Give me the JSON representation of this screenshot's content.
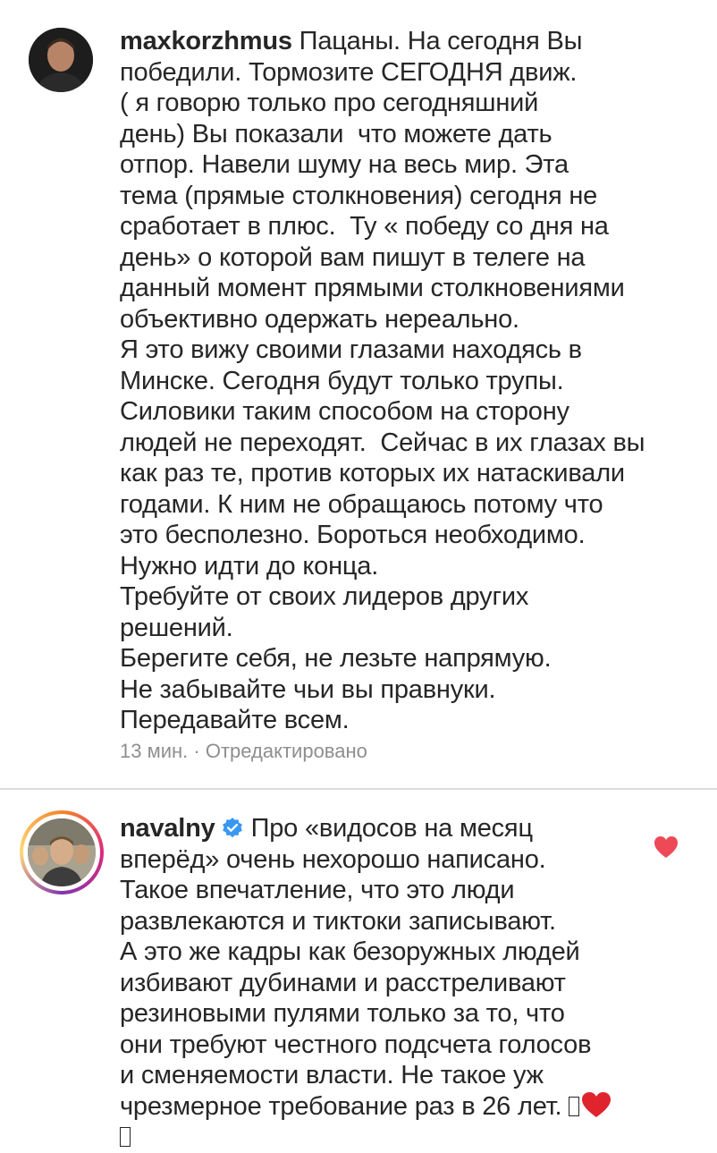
{
  "comments": [
    {
      "username": "maxkorzhmus",
      "body": " Пацаны. На сегодня Вы\nпобедили. Тормозите СЕГОДНЯ движ.\n( я говорю только про сегодняшний\nдень) Вы показали  что можете дать\nотпор. Навели шуму на весь мир. Эта\nтема (прямые столкновения) сегодня не\nсработает в плюс.  Ту « победу со дня на\nдень» о которой вам пишут в телеге на\nданный момент прямыми столкновениями\nобъективно одержать нереально.\nЯ это вижу своими глазами находясь в\nМинске. Сегодня будут только трупы.\nСиловики таким способом на сторону\nлюдей не переходят.  Сейчас в их глазах вы\nкак раз те, против которых их натаскивали\nгодами. К ним не обращаюсь потому что\nэто бесполезно. Бороться необходимо.\nНужно идти до конца.\nТребуйте от своих лидеров других\nрешений.\nБерегите себя, не лезьте напрямую.\nНе забывайте чьи вы правнуки.\nПередавайте всем.",
      "time": "13 мин.",
      "separator": "·",
      "edited": "Отредактировано"
    },
    {
      "username": "navalny",
      "body": "Про «видосов на месяц\nвперёд» очень нехорошо написано.\nТакое впечатление, что это люди\nразвлекаются и тиктоки записывают.\nА это же кадры как безоружных людей\nизбивают дубинами и расстреливают\nрезиновыми пулями только за то, что\nони требуют честного подсчета голосов\nи сменяемости власти. Не такое уж\nчрезмерное требование раз в 26 лет. "
    }
  ],
  "colors": {
    "text": "#262626",
    "meta": "#8e8e8e",
    "verified": "#3897f0",
    "like": "#ed4956"
  },
  "icons": {
    "verified": "verified-badge-icon",
    "like": "heart-icon"
  }
}
